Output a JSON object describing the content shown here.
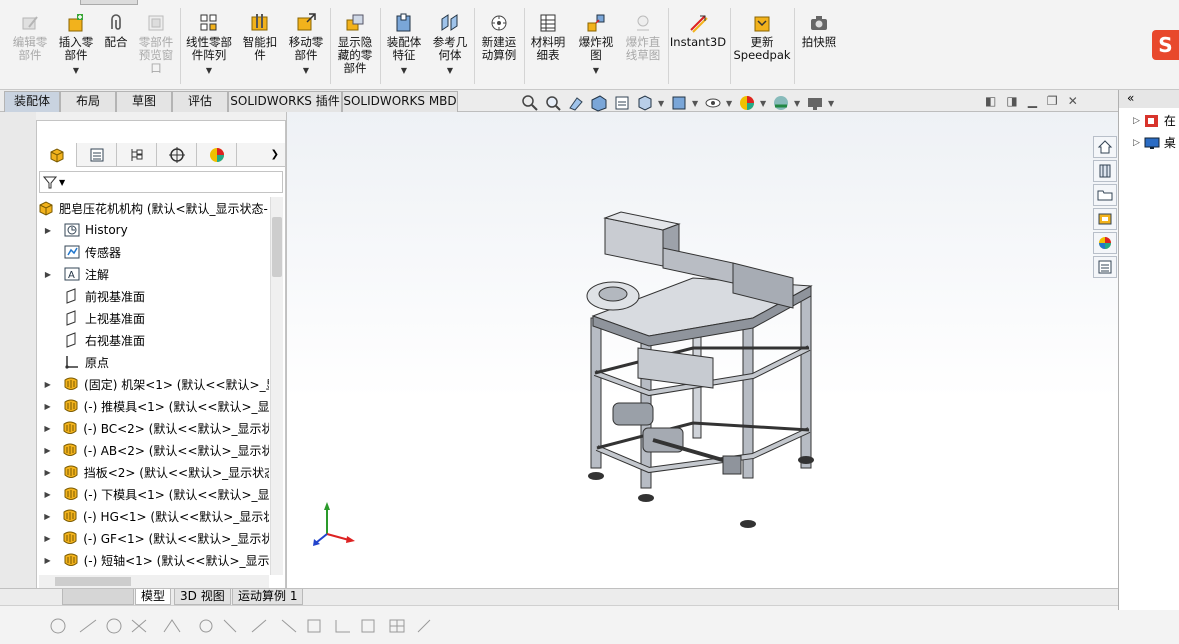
{
  "ribbon": {
    "items": [
      {
        "label": "编辑零\n部件",
        "icon": "edit-component-icon",
        "disabled": true
      },
      {
        "label": "插入零\n部件",
        "icon": "insert-component-icon",
        "disabled": false
      },
      {
        "label": "配合",
        "icon": "mate-icon",
        "disabled": false
      },
      {
        "label": "零部件\n预览窗\n口",
        "icon": "component-preview-icon",
        "disabled": true
      },
      {
        "label": "线性零部\n件阵列",
        "icon": "linear-pattern-icon",
        "disabled": false
      },
      {
        "label": "智能扣\n件",
        "icon": "smart-fasteners-icon",
        "disabled": false
      },
      {
        "label": "移动零\n部件",
        "icon": "move-component-icon",
        "disabled": false
      },
      {
        "label": "显示隐\n藏的零\n部件",
        "icon": "show-hidden-icon",
        "disabled": false
      },
      {
        "label": "装配体\n特征",
        "icon": "assembly-features-icon",
        "disabled": false
      },
      {
        "label": "参考几\n何体",
        "icon": "reference-geometry-icon",
        "disabled": false
      },
      {
        "label": "新建运\n动算例",
        "icon": "new-motion-study-icon",
        "disabled": false
      },
      {
        "label": "材料明\n细表",
        "icon": "bom-icon",
        "disabled": false
      },
      {
        "label": "爆炸视\n图",
        "icon": "exploded-view-icon",
        "disabled": false
      },
      {
        "label": "爆炸直\n线草图",
        "icon": "explode-line-sketch-icon",
        "disabled": true
      },
      {
        "label": "Instant3D",
        "icon": "instant3d-icon",
        "disabled": false
      },
      {
        "label": "更新\nSpeedpak",
        "icon": "update-speedpak-icon",
        "disabled": false
      },
      {
        "label": "拍快照",
        "icon": "snapshot-icon",
        "disabled": false
      }
    ],
    "sogou_label": "S"
  },
  "tabs": [
    "装配体",
    "布局",
    "草图",
    "评估",
    "SOLIDWORKS 插件",
    "SOLIDWORKS MBD"
  ],
  "active_tab": "装配体",
  "feature_tree": {
    "root": "肥皂压花机机构  (默认<默认_显示状态-",
    "nodes": [
      {
        "label": "History",
        "icon": "history-icon",
        "expand": true
      },
      {
        "label": "传感器",
        "icon": "sensor-icon",
        "expand": false
      },
      {
        "label": "注解",
        "icon": "annotation-icon",
        "expand": true
      },
      {
        "label": "前视基准面",
        "icon": "plane-icon",
        "expand": false
      },
      {
        "label": "上视基准面",
        "icon": "plane-icon",
        "expand": false
      },
      {
        "label": "右视基准面",
        "icon": "plane-icon",
        "expand": false
      },
      {
        "label": "原点",
        "icon": "origin-icon",
        "expand": false
      },
      {
        "label": "(固定) 机架<1> (默认<<默认>_显",
        "icon": "part-icon",
        "expand": true
      },
      {
        "label": "(-) 推模具<1> (默认<<默认>_显示",
        "icon": "part-icon",
        "expand": true
      },
      {
        "label": "(-) BC<2> (默认<<默认>_显示状态",
        "icon": "part-icon",
        "expand": true
      },
      {
        "label": "(-) AB<2> (默认<<默认>_显示状态",
        "icon": "part-icon",
        "expand": true
      },
      {
        "label": "挡板<2> (默认<<默认>_显示状态-",
        "icon": "part-icon",
        "expand": true
      },
      {
        "label": "(-) 下模具<1> (默认<<默认>_显示",
        "icon": "part-icon",
        "expand": true
      },
      {
        "label": "(-) HG<1> (默认<<默认>_显示状态",
        "icon": "part-icon",
        "expand": true
      },
      {
        "label": "(-) GF<1> (默认<<默认>_显示状态",
        "icon": "part-icon",
        "expand": true
      },
      {
        "label": "(-) 短轴<1> (默认<<默认>_显示状",
        "icon": "part-icon",
        "expand": true
      }
    ]
  },
  "bottom_tabs": [
    "模型",
    "3D 视图",
    "运动算例 1"
  ],
  "active_bottom_tab": "模型",
  "task_pane": {
    "collapse_label": "«",
    "items": [
      {
        "label": "在",
        "icon": "solidworks-resources-icon"
      },
      {
        "label": "桌",
        "icon": "desktop-icon"
      }
    ]
  },
  "colors": {
    "accent": "#f2b21c",
    "active_tab": "#c9d3e0",
    "disabled_text": "#a8a8a8"
  }
}
